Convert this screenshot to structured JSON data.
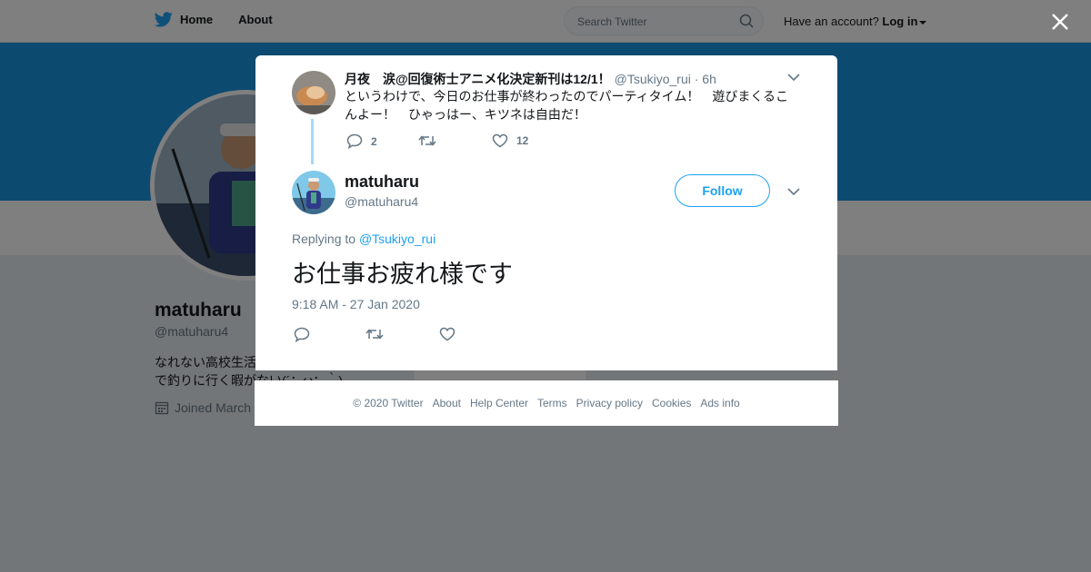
{
  "topbar": {
    "home_label": "Home",
    "about_label": "About",
    "search_placeholder": "Search Twitter",
    "account_prompt": "Have an account?",
    "login_label": "Log in"
  },
  "profile": {
    "name": "matuharu",
    "handle": "@matuharu4",
    "bio_line1": "なれない高校生活",
    "bio_line2": "で釣りに行く暇がない(´；ω；｀)",
    "joined": "Joined March"
  },
  "parent_tweet": {
    "name": "月夜　涙@回復術士アニメ化決定新刊は12/1！",
    "handle_time": "@Tsukiyo_rui · 6h",
    "text": "というわけで、今日のお仕事が終わったのでパーティタイム！　遊びまくるこんよー！　ひゃっはー、キツネは自由だ！",
    "reply_count": "2",
    "retweet_count": "",
    "like_count": "12"
  },
  "main_tweet": {
    "name": "matuharu",
    "handle": "@matuharu4",
    "follow_label": "Follow",
    "replying_prefix": "Replying to",
    "replying_to": "@Tsukiyo_rui",
    "text": "お仕事お疲れ様です",
    "timestamp": "9:18 AM - 27 Jan 2020"
  },
  "footer": {
    "copyright": "© 2020 Twitter",
    "links": [
      "About",
      "Help Center",
      "Terms",
      "Privacy policy",
      "Cookies",
      "Ads info"
    ]
  },
  "colors": {
    "accent": "#1da1f2",
    "banner": "#1b95e0",
    "thread_line": "#a4d9f9",
    "secondary_text": "#657786"
  }
}
